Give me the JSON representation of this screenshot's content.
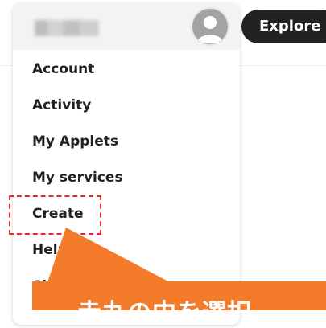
{
  "header": {
    "username": "",
    "explore_label": "Explore"
  },
  "menu": {
    "items": [
      {
        "label": "Account"
      },
      {
        "label": "Activity"
      },
      {
        "label": "My Applets"
      },
      {
        "label": "My services"
      },
      {
        "label": "Create"
      },
      {
        "label": "Help"
      },
      {
        "label": "Sign out"
      }
    ]
  },
  "annotation": {
    "callout_text": "赤丸の中を選択",
    "callout_color": "#f47b2a",
    "highlight_color": "#e8262a"
  },
  "icons": {
    "avatar": "user-avatar-icon"
  }
}
